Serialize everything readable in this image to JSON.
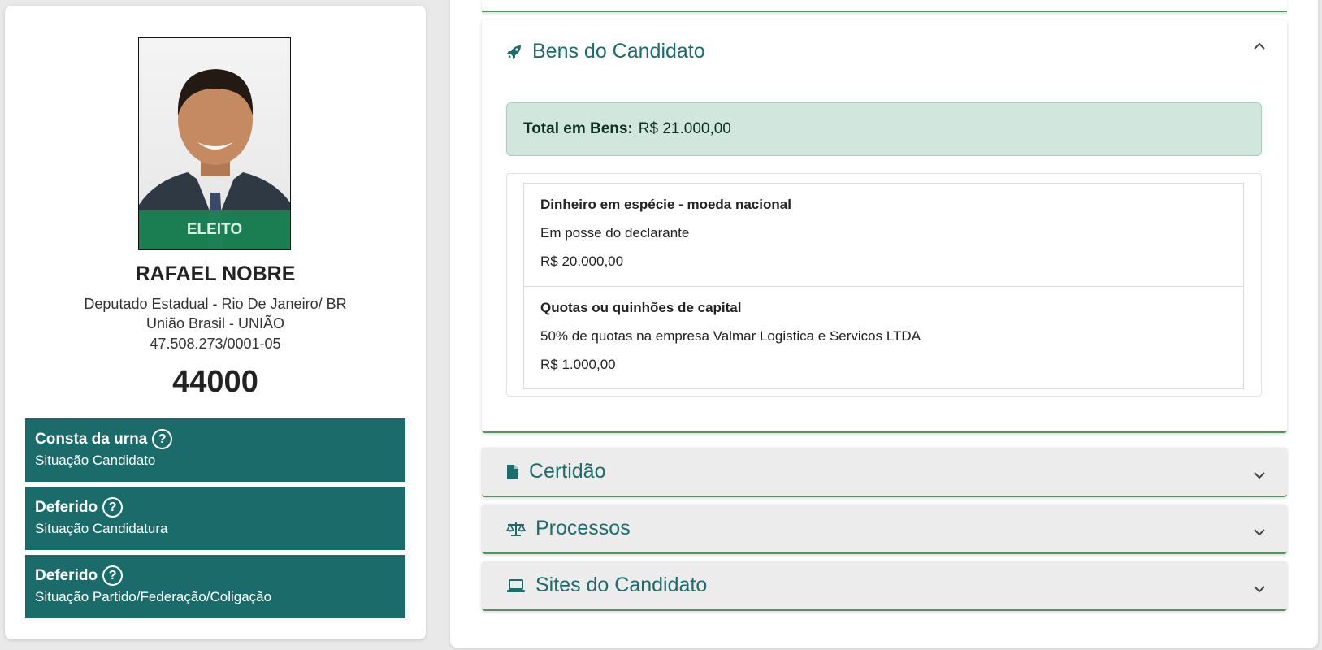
{
  "candidate": {
    "photo_badge": "ELEITO",
    "name": "RAFAEL NOBRE",
    "office": "Deputado Estadual - Rio De Janeiro/ BR",
    "party": "União Brasil - UNIÃO",
    "cnpj": "47.508.273/0001-05",
    "number": "44000"
  },
  "status_boxes": [
    {
      "title": "Consta da urna",
      "subtitle": "Situação Candidato"
    },
    {
      "title": "Deferido",
      "subtitle": "Situação Candidatura"
    },
    {
      "title": "Deferido",
      "subtitle": "Situação Partido/Federação/Coligação"
    }
  ],
  "bens": {
    "title": "Bens do Candidato",
    "total_label": "Total em Bens:",
    "total_value": "R$ 21.000,00",
    "items": [
      {
        "type": "Dinheiro em espécie - moeda nacional",
        "description": "Em posse do declarante",
        "value": "R$ 20.000,00"
      },
      {
        "type": "Quotas ou quinhões de capital",
        "description": "50% de quotas na empresa Valmar Logistica e Servicos LTDA",
        "value": "R$ 1.000,00"
      }
    ]
  },
  "sections": [
    {
      "title": "Certidão",
      "icon": "file-icon"
    },
    {
      "title": "Processos",
      "icon": "scale-icon"
    },
    {
      "title": "Sites do Candidato",
      "icon": "laptop-icon"
    }
  ],
  "colors": {
    "teal": "#1b6b6b",
    "success": "#198754",
    "alert_bg": "#d1e7dd"
  }
}
